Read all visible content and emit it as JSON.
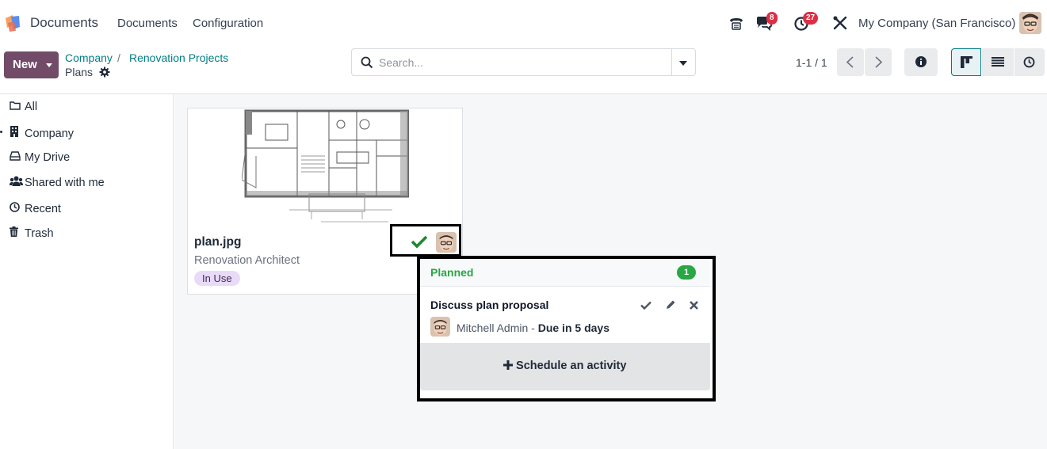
{
  "navbar": {
    "app_name": "Documents",
    "menu": [
      "Documents",
      "Configuration"
    ],
    "messages_badge": "8",
    "activities_badge": "27",
    "company": "My Company (San Francisco)"
  },
  "control_panel": {
    "new_label": "New",
    "breadcrumb": [
      "Company",
      "Renovation Projects"
    ],
    "breadcrumb_sep": "/",
    "current": "Plans",
    "search_placeholder": "Search...",
    "pager": "1-1 / 1"
  },
  "sidebar": {
    "items": [
      {
        "label": "All",
        "icon": "folder-icon"
      },
      {
        "label": "Company",
        "icon": "building-icon"
      },
      {
        "label": "My Drive",
        "icon": "drive-icon"
      },
      {
        "label": "Shared with me",
        "icon": "users-icon"
      },
      {
        "label": "Recent",
        "icon": "clock-icon"
      },
      {
        "label": "Trash",
        "icon": "trash-icon"
      }
    ]
  },
  "card": {
    "file_name": "plan.jpg",
    "owner": "Renovation Architect",
    "tag": "In Use"
  },
  "popover": {
    "section": "Planned",
    "count": "1",
    "activity_title": "Discuss plan proposal",
    "assignee": "Mitchell Admin",
    "separator": "-",
    "due": "Due in 5 days",
    "schedule_label": "Schedule an activity"
  },
  "colors": {
    "brand": "#714b67",
    "link": "#017e84",
    "planned": "#28a745",
    "badge": "#dc2f44"
  }
}
